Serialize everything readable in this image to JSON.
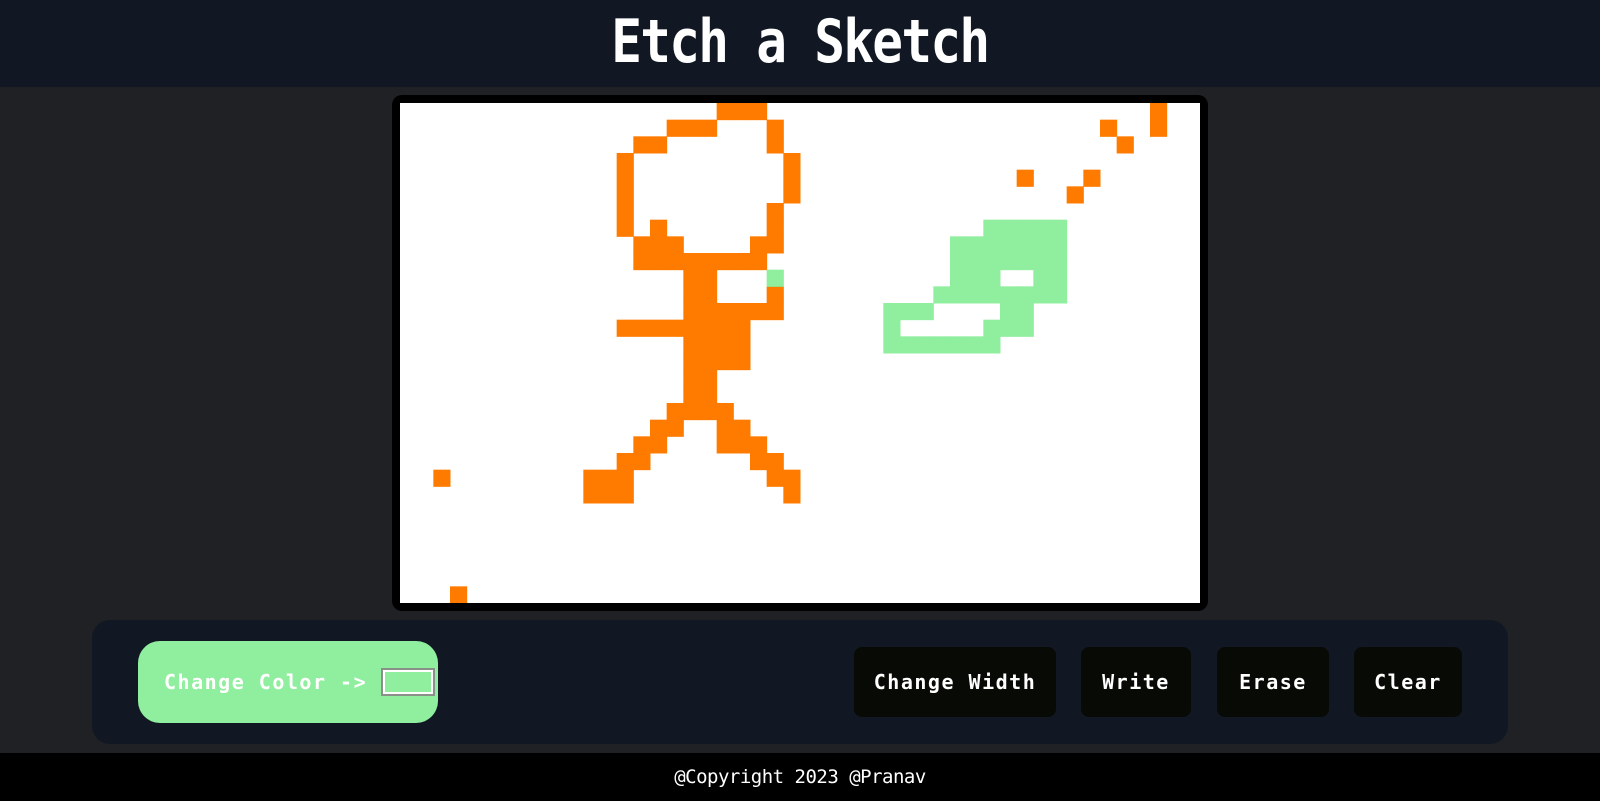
{
  "header": {
    "title": "Etch a Sketch"
  },
  "toolbar": {
    "change_color_label": "Change Color ->",
    "change_width_label": "Change Width",
    "write_label": "Write",
    "erase_label": "Erase",
    "clear_label": "Clear"
  },
  "footer": {
    "copyright": "@Copyright 2023 @Pranav"
  },
  "colors": {
    "current_pen": "#90ee9f",
    "header_bg": "#111823",
    "page_bg": "#202124",
    "orange": "#ff7b00",
    "green": "#90ee9f"
  },
  "sketch": {
    "grid_size": [
      48,
      30
    ],
    "orange_cells": [
      [
        19,
        0
      ],
      [
        20,
        0
      ],
      [
        21,
        0
      ],
      [
        16,
        1
      ],
      [
        17,
        1
      ],
      [
        18,
        1
      ],
      [
        22,
        1
      ],
      [
        14,
        2
      ],
      [
        15,
        2
      ],
      [
        22,
        2
      ],
      [
        13,
        3
      ],
      [
        23,
        3
      ],
      [
        13,
        4
      ],
      [
        23,
        4
      ],
      [
        13,
        5
      ],
      [
        23,
        5
      ],
      [
        13,
        6
      ],
      [
        22,
        6
      ],
      [
        13,
        7
      ],
      [
        15,
        7
      ],
      [
        22,
        7
      ],
      [
        14,
        8
      ],
      [
        15,
        8
      ],
      [
        16,
        8
      ],
      [
        21,
        8
      ],
      [
        22,
        8
      ],
      [
        14,
        9
      ],
      [
        15,
        9
      ],
      [
        16,
        9
      ],
      [
        17,
        9
      ],
      [
        18,
        9
      ],
      [
        19,
        9
      ],
      [
        20,
        9
      ],
      [
        21,
        9
      ],
      [
        17,
        10
      ],
      [
        18,
        10
      ],
      [
        17,
        11
      ],
      [
        18,
        11
      ],
      [
        22,
        11
      ],
      [
        17,
        12
      ],
      [
        18,
        12
      ],
      [
        19,
        12
      ],
      [
        20,
        12
      ],
      [
        21,
        12
      ],
      [
        22,
        12
      ],
      [
        13,
        13
      ],
      [
        14,
        13
      ],
      [
        15,
        13
      ],
      [
        16,
        13
      ],
      [
        17,
        13
      ],
      [
        18,
        13
      ],
      [
        19,
        13
      ],
      [
        20,
        13
      ],
      [
        17,
        14
      ],
      [
        18,
        14
      ],
      [
        19,
        14
      ],
      [
        20,
        14
      ],
      [
        17,
        15
      ],
      [
        18,
        15
      ],
      [
        19,
        15
      ],
      [
        20,
        15
      ],
      [
        17,
        16
      ],
      [
        18,
        16
      ],
      [
        17,
        17
      ],
      [
        18,
        17
      ],
      [
        16,
        18
      ],
      [
        17,
        18
      ],
      [
        18,
        18
      ],
      [
        19,
        18
      ],
      [
        15,
        19
      ],
      [
        16,
        19
      ],
      [
        19,
        19
      ],
      [
        20,
        19
      ],
      [
        14,
        20
      ],
      [
        15,
        20
      ],
      [
        19,
        20
      ],
      [
        20,
        20
      ],
      [
        21,
        20
      ],
      [
        13,
        21
      ],
      [
        14,
        21
      ],
      [
        21,
        21
      ],
      [
        22,
        21
      ],
      [
        11,
        22
      ],
      [
        12,
        22
      ],
      [
        13,
        22
      ],
      [
        22,
        22
      ],
      [
        23,
        22
      ],
      [
        11,
        23
      ],
      [
        12,
        23
      ],
      [
        13,
        23
      ],
      [
        23,
        23
      ],
      [
        2,
        22
      ],
      [
        3,
        29
      ],
      [
        45,
        0
      ],
      [
        42,
        1
      ],
      [
        45,
        1
      ],
      [
        43,
        2
      ],
      [
        37,
        4
      ],
      [
        41,
        4
      ],
      [
        40,
        5
      ]
    ],
    "green_cells": [
      [
        22,
        10
      ],
      [
        35,
        7
      ],
      [
        36,
        7
      ],
      [
        37,
        7
      ],
      [
        38,
        7
      ],
      [
        39,
        7
      ],
      [
        33,
        8
      ],
      [
        34,
        8
      ],
      [
        35,
        8
      ],
      [
        36,
        8
      ],
      [
        37,
        8
      ],
      [
        38,
        8
      ],
      [
        39,
        8
      ],
      [
        33,
        9
      ],
      [
        34,
        9
      ],
      [
        35,
        9
      ],
      [
        36,
        9
      ],
      [
        37,
        9
      ],
      [
        38,
        9
      ],
      [
        39,
        9
      ],
      [
        33,
        10
      ],
      [
        34,
        10
      ],
      [
        35,
        10
      ],
      [
        38,
        10
      ],
      [
        39,
        10
      ],
      [
        32,
        11
      ],
      [
        33,
        11
      ],
      [
        34,
        11
      ],
      [
        35,
        11
      ],
      [
        36,
        11
      ],
      [
        37,
        11
      ],
      [
        38,
        11
      ],
      [
        39,
        11
      ],
      [
        29,
        12
      ],
      [
        30,
        12
      ],
      [
        31,
        12
      ],
      [
        36,
        12
      ],
      [
        37,
        12
      ],
      [
        29,
        13
      ],
      [
        35,
        13
      ],
      [
        36,
        13
      ],
      [
        37,
        13
      ],
      [
        29,
        14
      ],
      [
        30,
        14
      ],
      [
        31,
        14
      ],
      [
        32,
        14
      ],
      [
        33,
        14
      ],
      [
        34,
        14
      ],
      [
        35,
        14
      ]
    ]
  }
}
